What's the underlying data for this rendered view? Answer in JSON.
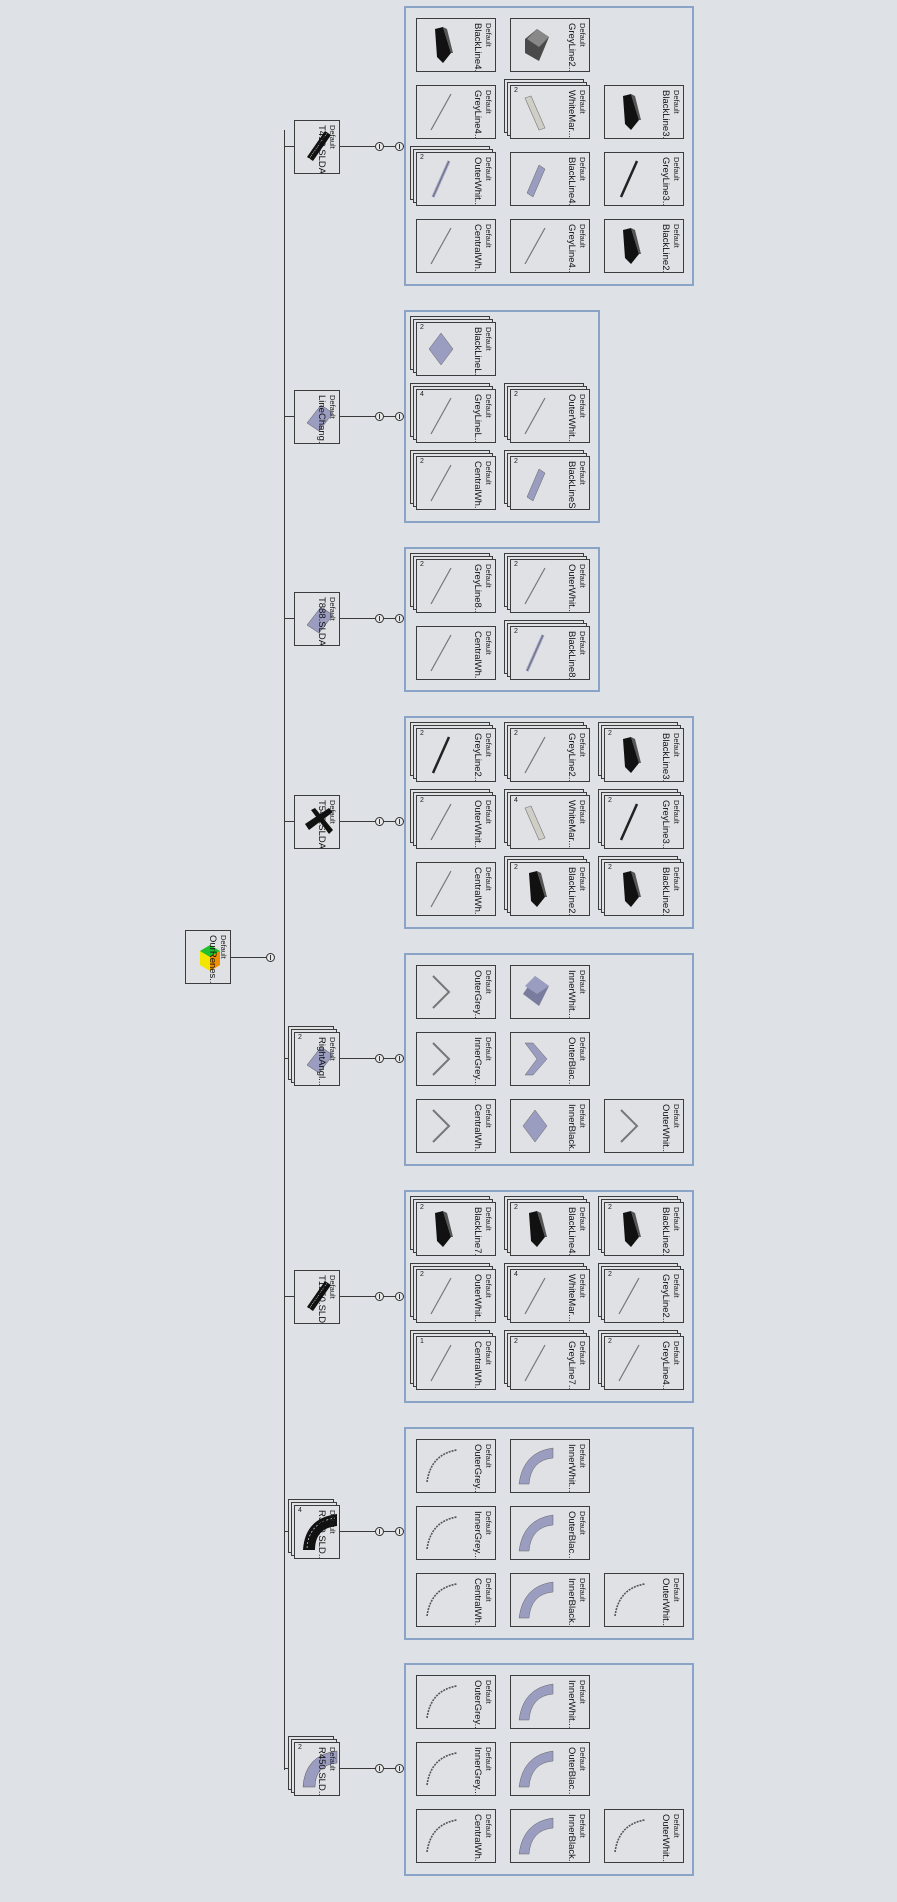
{
  "root": {
    "name": "OurRenes...",
    "config": "Default"
  },
  "assemblies": [
    {
      "name": "T410.SLDA...",
      "config": "Default",
      "qty": "",
      "parts": [
        {
          "name": "BlackLine4...",
          "config": "Default",
          "qty": "",
          "shape": "black-box"
        },
        {
          "name": "GreyLine2...",
          "config": "Default",
          "qty": "",
          "shape": "grey-cube"
        },
        {
          "name": "GreyLine4...",
          "config": "Default",
          "qty": "",
          "shape": "thin-line"
        },
        {
          "name": "WhiteMar...",
          "config": "Default",
          "qty": "2",
          "shape": "white-bar"
        },
        {
          "name": "BlackLine3...",
          "config": "Default",
          "qty": "",
          "shape": "black-box"
        },
        {
          "name": "OuterWhit...",
          "config": "Default",
          "qty": "2",
          "shape": "lav-line"
        },
        {
          "name": "BlackLine4...",
          "config": "Default",
          "qty": "",
          "shape": "lav-bar"
        },
        {
          "name": "GreyLine3...",
          "config": "Default",
          "qty": "",
          "shape": "dark-line"
        },
        {
          "name": "CentralWh...",
          "config": "Default",
          "qty": "",
          "shape": "thin-line"
        },
        {
          "name": "GreyLine4...",
          "config": "Default",
          "qty": "",
          "shape": "thin-line"
        },
        {
          "name": "BlackLine2...",
          "config": "Default",
          "qty": "",
          "shape": "black-box"
        }
      ]
    },
    {
      "name": "LineChang...",
      "config": "Default",
      "qty": "",
      "parts": [
        {
          "name": "BlackLineL...",
          "config": "Default",
          "qty": "2",
          "shape": "lav-diamond"
        },
        {
          "name": "GreyLineL...",
          "config": "Default",
          "qty": "4",
          "shape": "thin-line"
        },
        {
          "name": "OuterWhit...",
          "config": "Default",
          "qty": "2",
          "shape": "thin-line"
        },
        {
          "name": "CentralWh...",
          "config": "Default",
          "qty": "2",
          "shape": "thin-line"
        },
        {
          "name": "BlackLineS...",
          "config": "Default",
          "qty": "2",
          "shape": "lav-bar"
        }
      ]
    },
    {
      "name": "T888.SLDA...",
      "config": "Default",
      "qty": "",
      "parts": [
        {
          "name": "GreyLine8...",
          "config": "Default",
          "qty": "2",
          "shape": "thin-line"
        },
        {
          "name": "OuterWhit...",
          "config": "Default",
          "qty": "2",
          "shape": "thin-line"
        },
        {
          "name": "CentralWh...",
          "config": "Default",
          "qty": "",
          "shape": "thin-line"
        },
        {
          "name": "BlackLine8...",
          "config": "Default",
          "qty": "2",
          "shape": "lav-line"
        }
      ]
    },
    {
      "name": "T548.SLDA...",
      "config": "Default",
      "qty": "",
      "parts": [
        {
          "name": "GreyLine2...",
          "config": "Default",
          "qty": "2",
          "shape": "dark-line"
        },
        {
          "name": "GreyLine2...",
          "config": "Default",
          "qty": "2",
          "shape": "thin-line"
        },
        {
          "name": "BlackLine3...",
          "config": "Default",
          "qty": "2",
          "shape": "black-box"
        },
        {
          "name": "OuterWhit...",
          "config": "Default",
          "qty": "2",
          "shape": "thin-line"
        },
        {
          "name": "WhiteMar...",
          "config": "Default",
          "qty": "4",
          "shape": "white-bar"
        },
        {
          "name": "GreyLine3...",
          "config": "Default",
          "qty": "2",
          "shape": "dark-line"
        },
        {
          "name": "CentralWh...",
          "config": "Default",
          "qty": "",
          "shape": "thin-line"
        },
        {
          "name": "BlackLine2...",
          "config": "Default",
          "qty": "2",
          "shape": "black-box"
        },
        {
          "name": "BlackLine2...",
          "config": "Default",
          "qty": "2",
          "shape": "black-box"
        }
      ]
    },
    {
      "name": "RightAngl...",
      "config": "Default",
      "qty": "2",
      "parts": [
        {
          "name": "OuterGrey...",
          "config": "Default",
          "qty": "",
          "shape": "chevron"
        },
        {
          "name": "InnerWhit...",
          "config": "Default",
          "qty": "",
          "shape": "lav-cube"
        },
        {
          "name": "InnerGrey...",
          "config": "Default",
          "qty": "",
          "shape": "chevron"
        },
        {
          "name": "OuterBlac...",
          "config": "Default",
          "qty": "",
          "shape": "lav-chevron"
        },
        {
          "name": "CentralWh...",
          "config": "Default",
          "qty": "",
          "shape": "chevron"
        },
        {
          "name": "InnerBlack...",
          "config": "Default",
          "qty": "",
          "shape": "lav-diamond"
        },
        {
          "name": "OuterWhit...",
          "config": "Default",
          "qty": "",
          "shape": "chevron"
        }
      ]
    },
    {
      "name": "T1250.SLD...",
      "config": "Default",
      "qty": "",
      "parts": [
        {
          "name": "BlackLine7...",
          "config": "Default",
          "qty": "2",
          "shape": "black-box"
        },
        {
          "name": "BlackLine4...",
          "config": "Default",
          "qty": "2",
          "shape": "black-box"
        },
        {
          "name": "BlackLine2...",
          "config": "Default",
          "qty": "2",
          "shape": "black-box"
        },
        {
          "name": "OuterWhit...",
          "config": "Default",
          "qty": "2",
          "shape": "thin-line"
        },
        {
          "name": "WhiteMar...",
          "config": "Default",
          "qty": "4",
          "shape": "thin-line"
        },
        {
          "name": "GreyLine2...",
          "config": "Default",
          "qty": "2",
          "shape": "thin-line"
        },
        {
          "name": "CentralWh...",
          "config": "Default",
          "qty": "1",
          "shape": "thin-line"
        },
        {
          "name": "GreyLine7...",
          "config": "Default",
          "qty": "2",
          "shape": "thin-line"
        },
        {
          "name": "GreyLine4...",
          "config": "Default",
          "qty": "2",
          "shape": "thin-line"
        }
      ]
    },
    {
      "name": "R300.SLD...",
      "config": "Default",
      "qty": "4",
      "parts": [
        {
          "name": "OuterGrey...",
          "config": "Default",
          "qty": "",
          "shape": "curve"
        },
        {
          "name": "InnerWhit...",
          "config": "Default",
          "qty": "",
          "shape": "lav-arc"
        },
        {
          "name": "InnerGrey...",
          "config": "Default",
          "qty": "",
          "shape": "curve"
        },
        {
          "name": "OuterBlac...",
          "config": "Default",
          "qty": "",
          "shape": "lav-arc"
        },
        {
          "name": "CentralWh...",
          "config": "Default",
          "qty": "",
          "shape": "curve"
        },
        {
          "name": "InnerBlack...",
          "config": "Default",
          "qty": "",
          "shape": "lav-arc"
        },
        {
          "name": "OuterWhit...",
          "config": "Default",
          "qty": "",
          "shape": "curve"
        }
      ]
    },
    {
      "name": "R450.SLD...",
      "config": "Default",
      "qty": "2",
      "parts": [
        {
          "name": "OuterGrey...",
          "config": "Default",
          "qty": "",
          "shape": "curve"
        },
        {
          "name": "InnerWhit...",
          "config": "Default",
          "qty": "",
          "shape": "lav-arc"
        },
        {
          "name": "InnerGrey...",
          "config": "Default",
          "qty": "",
          "shape": "curve"
        },
        {
          "name": "OuterBlac...",
          "config": "Default",
          "qty": "",
          "shape": "lav-arc"
        },
        {
          "name": "CentralWh...",
          "config": "Default",
          "qty": "",
          "shape": "curve"
        },
        {
          "name": "InnerBlack...",
          "config": "Default",
          "qty": "",
          "shape": "lav-arc"
        },
        {
          "name": "OuterWhit...",
          "config": "Default",
          "qty": "",
          "shape": "curve"
        }
      ]
    }
  ],
  "colors": {
    "group_border": "#8aa4c8",
    "background": "#dee2e6",
    "lavender": "#9a9cc0"
  }
}
